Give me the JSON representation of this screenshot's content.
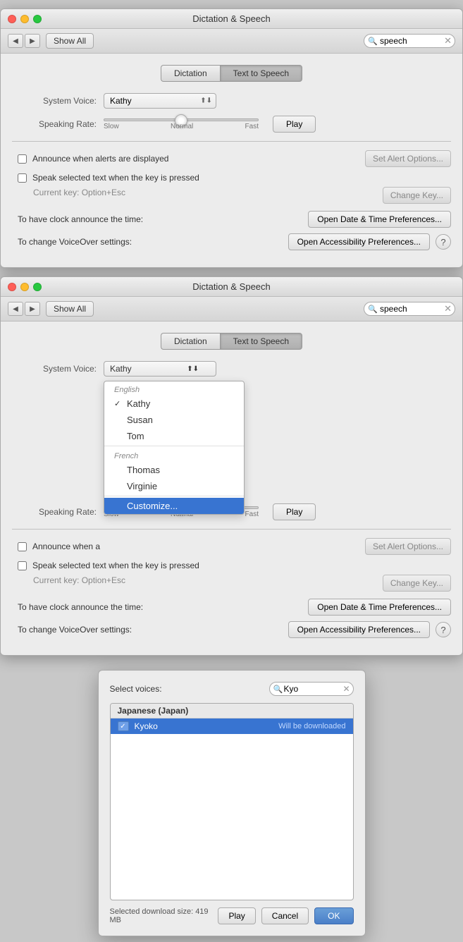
{
  "window1": {
    "title": "Dictation & Speech",
    "search_placeholder": "speech",
    "search_value": "speech",
    "nav_back": "◀",
    "nav_forward": "▶",
    "show_all": "Show All",
    "tabs": [
      {
        "label": "Dictation",
        "active": false
      },
      {
        "label": "Text to Speech",
        "active": true
      }
    ],
    "system_voice_label": "System Voice:",
    "system_voice_value": "Kathy",
    "speaking_rate_label": "Speaking Rate:",
    "slider_slow": "Slow",
    "slider_normal": "Normal",
    "slider_fast": "Fast",
    "play_button": "Play",
    "announce_checkbox": "Announce when alerts are displayed",
    "announce_checked": false,
    "speak_checkbox": "Speak selected text when the key is pressed",
    "speak_checked": false,
    "current_key": "Current key: Option+Esc",
    "change_key_button": "Change Key...",
    "set_alert_button": "Set Alert Options...",
    "clock_label": "To have clock announce the time:",
    "clock_button": "Open Date & Time Preferences...",
    "voiceover_label": "To change VoiceOver settings:",
    "voiceover_button": "Open Accessibility Preferences...",
    "help_button": "?"
  },
  "window2": {
    "title": "Dictation & Speech",
    "search_placeholder": "speech",
    "search_value": "speech",
    "nav_back": "◀",
    "nav_forward": "▶",
    "show_all": "Show All",
    "tabs": [
      {
        "label": "Dictation",
        "active": false
      },
      {
        "label": "Text to Speech",
        "active": true
      }
    ],
    "system_voice_label": "System Voice:",
    "speaking_rate_label": "Speaking Rate:",
    "play_button": "Play",
    "announce_checkbox": "Announce when a",
    "speak_checkbox": "Speak selected text when the key is pressed",
    "current_key": "Current key: Option+Esc",
    "change_key_button": "Change Key...",
    "set_alert_button": "Set Alert Options...",
    "clock_label": "To have clock announce the time:",
    "clock_button": "Open Date & Time Preferences...",
    "voiceover_label": "To change VoiceOver settings:",
    "voiceover_button": "Open Accessibility Preferences...",
    "help_button": "?",
    "dropdown": {
      "groups": [
        {
          "label": "English",
          "items": [
            {
              "name": "Kathy",
              "selected": true
            },
            {
              "name": "Susan",
              "selected": false
            },
            {
              "name": "Tom",
              "selected": false
            }
          ]
        },
        {
          "label": "French",
          "items": [
            {
              "name": "Thomas",
              "selected": false
            },
            {
              "name": "Virginie",
              "selected": false
            }
          ]
        }
      ],
      "customize": "Customize..."
    }
  },
  "dialog": {
    "select_voices_label": "Select voices:",
    "search_value": "Kyo",
    "search_placeholder": "Kyo",
    "voice_groups": [
      {
        "language": "Japanese (Japan)",
        "voices": [
          {
            "name": "Kyoko",
            "checked": true,
            "status": "Will be downloaded",
            "selected": true
          }
        ]
      }
    ],
    "download_size": "Selected download size: 419 MB",
    "play_button": "Play",
    "cancel_button": "Cancel",
    "ok_button": "OK"
  }
}
